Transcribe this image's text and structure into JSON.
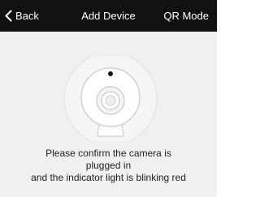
{
  "nav": {
    "back_label": "Back",
    "title": "Add Device",
    "qr_label": "QR Mode"
  },
  "icons": {
    "back": "chevron-left-icon",
    "camera": "camera-illustration"
  },
  "instruction": {
    "line1": "Please confirm the camera is",
    "line2": "plugged in",
    "line3": "and the indicator light is blinking red"
  },
  "colors": {
    "nav_background": "#111111",
    "nav_text": "#ffffff",
    "page_background": "#f0f0f0",
    "indicator": "#111111"
  }
}
